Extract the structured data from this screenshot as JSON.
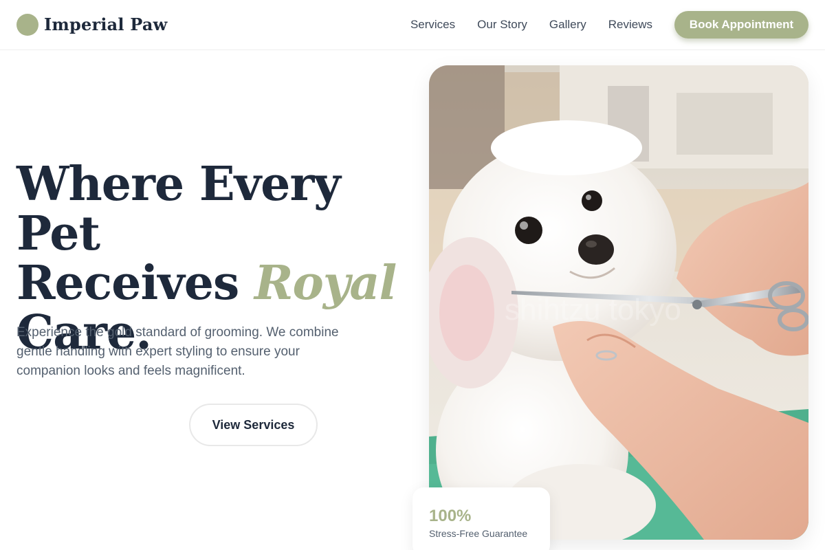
{
  "brand": {
    "name": "Imperial Paw",
    "accent_color": "#a8b38a"
  },
  "nav": {
    "links": [
      "Services",
      "Our Story",
      "Gallery",
      "Reviews"
    ],
    "cta_label": "Book Appointment"
  },
  "hero": {
    "title_line1": "Where Every Pet",
    "title_line2_plain": "Receives ",
    "title_line2_accent": "Royal",
    "title_line3": "Care.",
    "subtitle": "Experience the gold standard of grooming. We combine gentle handling with expert styling to ensure your companion looks and feels magnificent.",
    "button_label": "View Services"
  },
  "image": {
    "watermark": "shihtzu tokyo"
  },
  "badge": {
    "value": "100%",
    "label": "Stress-Free Guarantee"
  }
}
